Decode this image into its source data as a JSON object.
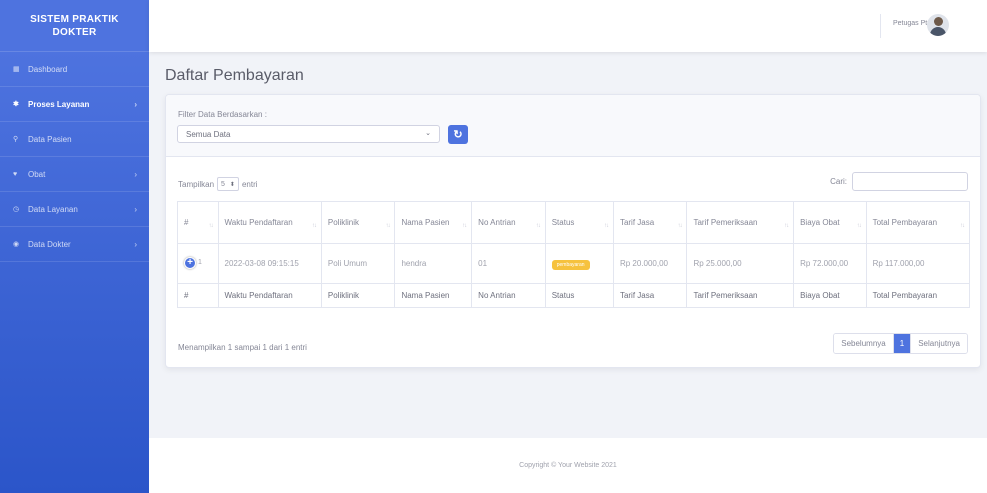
{
  "brand": {
    "line1": "SISTEM PRAKTIK",
    "line2": "DOKTER"
  },
  "sidebar": {
    "items": [
      {
        "label": "Dashboard",
        "icon": "tachometer-icon",
        "glyph": "▦",
        "active": false,
        "has_chevron": false
      },
      {
        "label": "Proses Layanan",
        "icon": "gear-icon",
        "glyph": "✱",
        "active": true,
        "has_chevron": true
      },
      {
        "label": "Data Pasien",
        "icon": "user-icon",
        "glyph": "⚲",
        "active": false,
        "has_chevron": false
      },
      {
        "label": "Obat",
        "icon": "heart-icon",
        "glyph": "♥",
        "active": false,
        "has_chevron": true
      },
      {
        "label": "Data Layanan",
        "icon": "clock-icon",
        "glyph": "◷",
        "active": false,
        "has_chevron": true
      },
      {
        "label": "Data Dokter",
        "icon": "circle-icon",
        "glyph": "◉",
        "active": false,
        "has_chevron": true
      }
    ]
  },
  "topbar": {
    "user_name": "Petugas Ptu"
  },
  "page": {
    "title": "Daftar Pembayaran"
  },
  "filter": {
    "label": "Filter Data Berdasarkan :",
    "selected": "Semua Data",
    "refresh_glyph": "↻"
  },
  "table_controls": {
    "show_prefix": "Tampilkan",
    "show_value": "5",
    "show_suffix": "entri",
    "search_label": "Cari:"
  },
  "table": {
    "headers": [
      "#",
      "Waktu Pendaftaran",
      "Poliklinik",
      "Nama Pasien",
      "No Antrian",
      "Status",
      "Tarif Jasa",
      "Tarif Pemeriksaan",
      "Biaya Obat",
      "Total Pembayaran"
    ],
    "rows": [
      {
        "no": "1",
        "waktu": "2022-03-08 09:15:15",
        "poliklinik": "Poli Umum",
        "nama": "hendra",
        "antrian": "01",
        "status": "pembayaran",
        "tarif_jasa": "Rp 20.000,00",
        "tarif_pemeriksaan": "Rp 25.000,00",
        "biaya_obat": "Rp 72.000,00",
        "total": "Rp 117.000,00"
      }
    ],
    "footer": [
      "#",
      "Waktu Pendaftaran",
      "Poliklinik",
      "Nama Pasien",
      "No Antrian",
      "Status",
      "Tarif Jasa",
      "Tarif Pemeriksaan",
      "Biaya Obat",
      "Total Pembayaran"
    ]
  },
  "info": "Menampilkan 1 sampai 1 dari 1 entri",
  "pagination": {
    "prev": "Sebelumnya",
    "current": "1",
    "next": "Selanjutnya"
  },
  "footer": {
    "text": "Copyright © Your Website 2021"
  },
  "colors": {
    "primary": "#4e73df",
    "warning": "#f6c23e",
    "background": "#f1f3f8"
  }
}
